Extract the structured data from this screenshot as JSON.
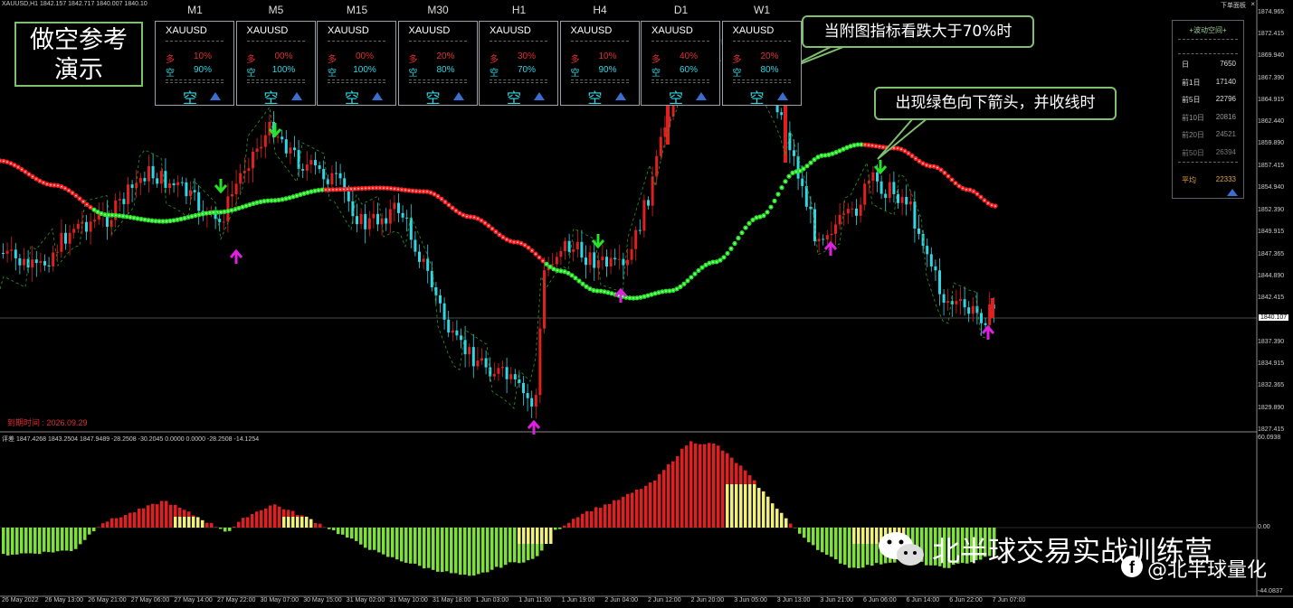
{
  "window": {
    "title": "XAUUSD,H1  1842.157 1842.717 1840.007 1840.10",
    "corner_label": "下单面板",
    "close_glyph": "×"
  },
  "demo_box": {
    "line1": "做空参考",
    "line2": "演示"
  },
  "timeframes": [
    {
      "tf": "M1",
      "symbol": "XAUUSD",
      "long_label": "多",
      "long": "10%",
      "short_label": "空",
      "short": "90%",
      "signal": "空"
    },
    {
      "tf": "M5",
      "symbol": "XAUUSD",
      "long_label": "多",
      "long": "00%",
      "short_label": "空",
      "short": "100%",
      "signal": "空"
    },
    {
      "tf": "M15",
      "symbol": "XAUUSD",
      "long_label": "多",
      "long": "00%",
      "short_label": "空",
      "short": "100%",
      "signal": "空"
    },
    {
      "tf": "M30",
      "symbol": "XAUUSD",
      "long_label": "多",
      "long": "20%",
      "short_label": "空",
      "short": "80%",
      "signal": "空"
    },
    {
      "tf": "H1",
      "symbol": "XAUUSD",
      "long_label": "多",
      "long": "30%",
      "short_label": "空",
      "short": "70%",
      "signal": "空"
    },
    {
      "tf": "H4",
      "symbol": "XAUUSD",
      "long_label": "多",
      "long": "10%",
      "short_label": "空",
      "short": "90%",
      "signal": "空"
    },
    {
      "tf": "D1",
      "symbol": "XAUUSD",
      "long_label": "多",
      "long": "40%",
      "short_label": "空",
      "short": "60%",
      "signal": "空"
    },
    {
      "tf": "W1",
      "symbol": "XAUUSD",
      "long_label": "多",
      "long": "20%",
      "short_label": "空",
      "short": "80%",
      "signal": "空"
    }
  ],
  "callouts": {
    "one": "当附图指标看跌大于70%时",
    "two": "出现绿色向下箭头，并收线时"
  },
  "stats": {
    "header": "+波动空间+",
    "rows": [
      {
        "k": "日",
        "v": "7650"
      },
      {
        "k": "前1日",
        "v": "17140"
      },
      {
        "k": "前5日",
        "v": "22796"
      },
      {
        "k": "前10日",
        "v": "20816"
      },
      {
        "k": "前20日",
        "v": "24521"
      },
      {
        "k": "前50日",
        "v": "26394"
      }
    ],
    "avg_label": "平均",
    "avg_value": "22333"
  },
  "expire_text": "到期时间 : 2026.09.29",
  "indicator_label": "评差 1847.4268 1843.2504 1847.9489 -28.2508 -30.2045 0.0000 0.0000 -28.2508 -14.1254",
  "price_axis": [
    "1874.965",
    "1872.415",
    "1869.940",
    "1867.390",
    "1864.915",
    "1862.440",
    "1859.890",
    "1857.415",
    "1854.940",
    "1852.390",
    "1849.915",
    "1847.365",
    "1844.890",
    "1842.415",
    "1837.390",
    "1834.915",
    "1832.365",
    "1829.890",
    "1827.415"
  ],
  "current_price": "1840.107",
  "indicator_axis": {
    "top": "60.0938",
    "zero": "0.00",
    "bottom": "-44.0837"
  },
  "time_axis": [
    "26 May 2022",
    "26 May 13:00",
    "26 May 21:00",
    "27 May 06:00",
    "27 May 14:00",
    "27 May 22:00",
    "30 May 07:00",
    "30 May 15:00",
    "31 May 02:00",
    "31 May 10:00",
    "31 May 18:00",
    "1 Jun 03:00",
    "1 Jun 11:00",
    "1 Jun 19:00",
    "2 Jun 04:00",
    "2 Jun 12:00",
    "2 Jun 20:00",
    "3 Jun 05:00",
    "3 Jun 13:00",
    "3 Jun 21:00",
    "6 Jun 06:00",
    "6 Jun 14:00",
    "6 Jun 22:00",
    "7 Jun 07:00"
  ],
  "watermark": {
    "main": "北半球交易实战训练营",
    "secondary": "@北半球量化"
  },
  "colors": {
    "bull": "#e02020",
    "bear": "#31d6e4",
    "curve_up": "#ff2020",
    "curve_down": "#22e822",
    "hist_red": "#e02020",
    "hist_green": "#7ee03a",
    "hist_yellow": "#f0f07a",
    "frame_green": "#7ec06d"
  }
}
